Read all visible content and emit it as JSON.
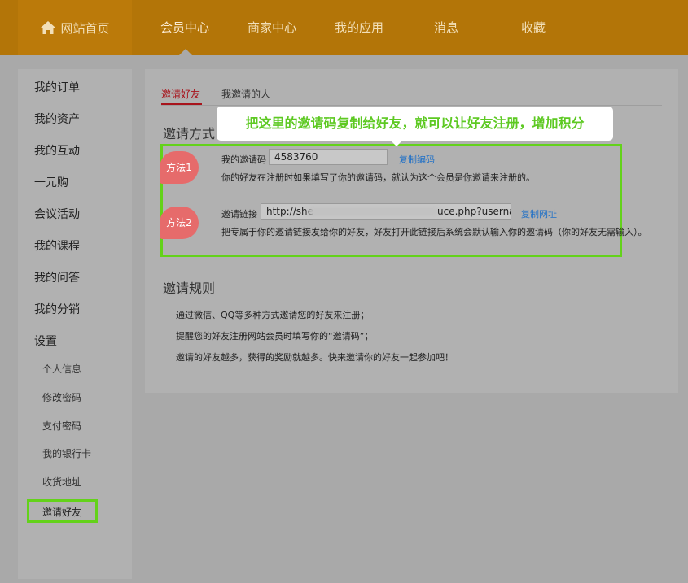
{
  "nav": {
    "home": "网站首页",
    "items": [
      "会员中心",
      "商家中心",
      "我的应用",
      "消息",
      "收藏"
    ]
  },
  "sidebar": {
    "items": [
      "我的订单",
      "我的资产",
      "我的互动",
      "一元购",
      "会议活动",
      "我的课程",
      "我的问答",
      "我的分销",
      "设置"
    ],
    "sub_items": [
      "个人信息",
      "修改密码",
      "支付密码",
      "我的银行卡",
      "收货地址",
      "邀请好友"
    ]
  },
  "tabs": [
    "邀请好友",
    "我邀请的人"
  ],
  "invite": {
    "section_title": "邀请方式",
    "tooltip": "把这里的邀请码复制给好友，就可以让好友注册，增加积分",
    "method1": {
      "badge": "方法1",
      "label": "我的邀请码",
      "value": "4583760",
      "copy": "复制编码",
      "desc": "你的好友在注册时如果填写了你的邀请码，就认为这个会员是你邀请来注册的。"
    },
    "method2": {
      "badge": "方法2",
      "label": "邀请链接",
      "value_start": "http://she",
      "value_end": "uce.php?userna",
      "copy": "复制网址",
      "desc": "把专属于你的邀请链接发给你的好友，好友打开此链接后系统会默认输入你的邀请码（你的好友无需输入）。"
    }
  },
  "rules": {
    "title": "邀请规则",
    "lines": [
      "通过微信、QQ等多种方式邀请您的好友来注册；",
      "提醒您的好友注册网站会员时填写你的“邀请码”；",
      "邀请的好友越多，获得的奖励就越多。快来邀请你的好友一起参加吧！"
    ]
  },
  "colors": {
    "nav_bg": "#b37508",
    "highlight": "#63d21a",
    "badge": "#e66b6b",
    "link": "#1d6fc7",
    "active_tab": "#a8141c"
  }
}
